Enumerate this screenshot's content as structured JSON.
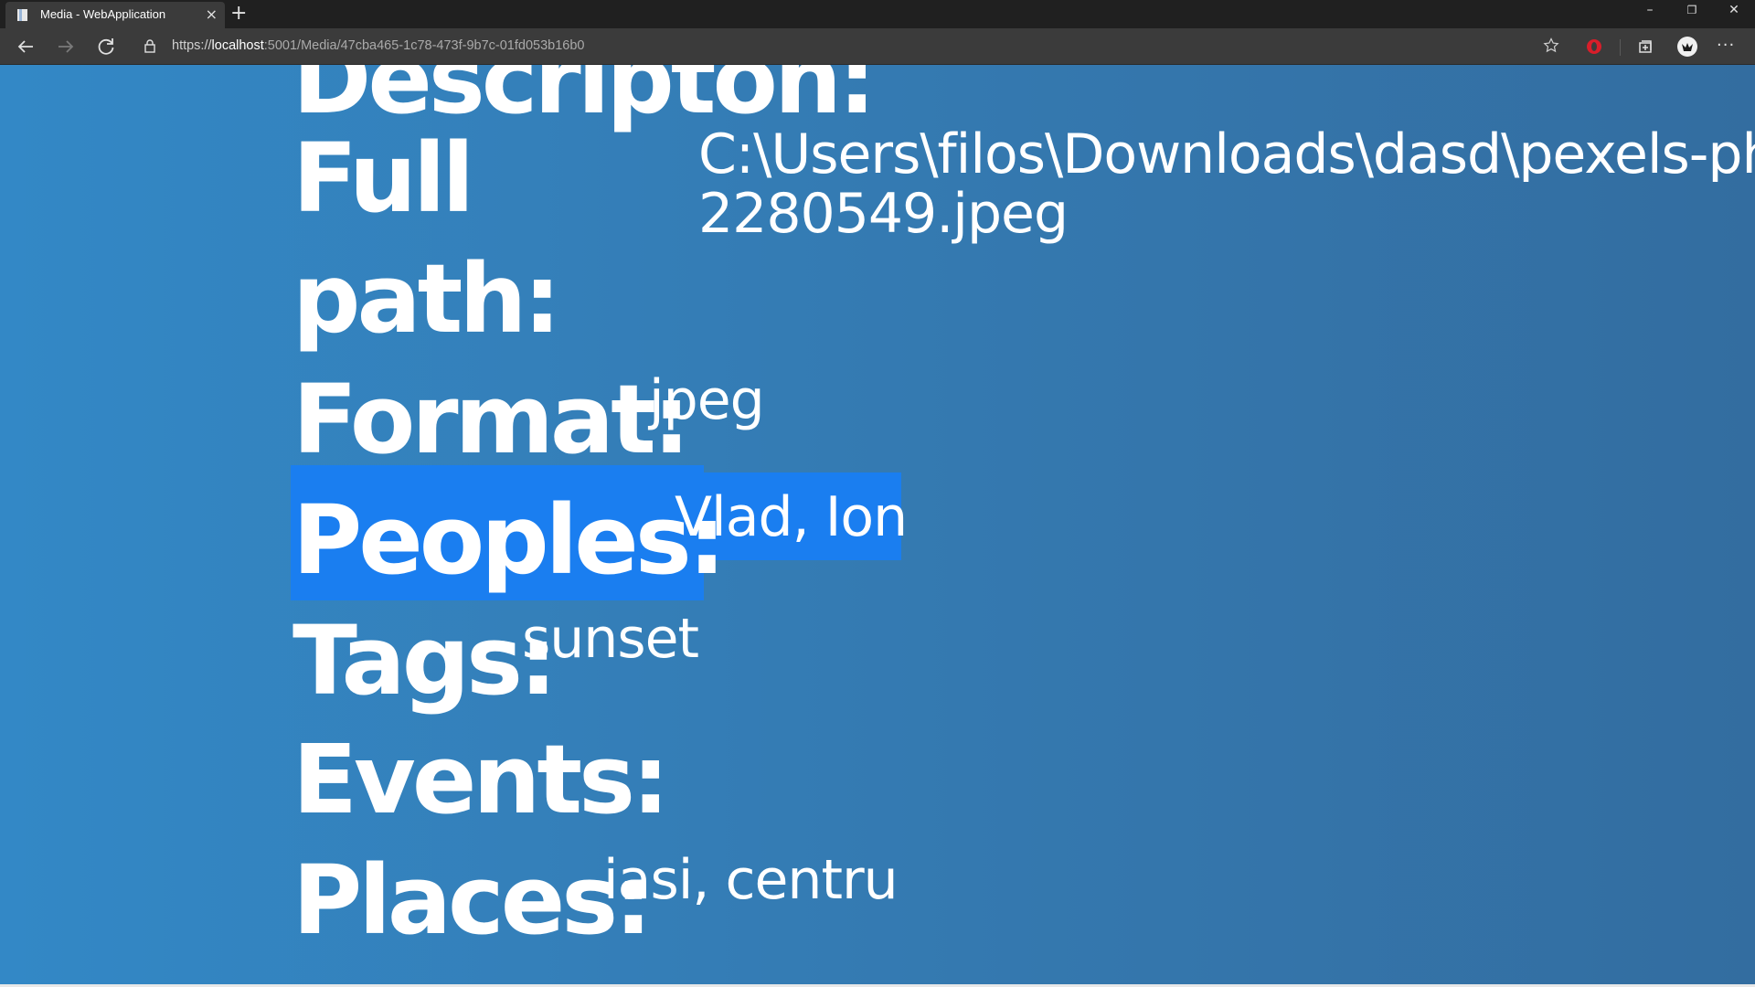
{
  "browser": {
    "tab_title": "Media - WebApplication",
    "tab_close": "×",
    "new_tab": "+",
    "url_scheme": "https://",
    "url_host": "localhost",
    "url_rest": ":5001/Media/47cba465-1c78-473f-9b7c-01fd053b16b0",
    "window_minimize": "–",
    "window_restore": "❐",
    "window_close": "✕",
    "more_menu": "···"
  },
  "media": {
    "description_label": "Descripton:",
    "description_value": "",
    "full_path_label_line1": "Full",
    "full_path_label_line2": "path:",
    "full_path_line1": "C:\\Users\\filos\\Downloads\\dasd\\pexels-ph",
    "full_path_line2": "2280549.jpeg",
    "format_label": "Format:",
    "format_value": "jpeg",
    "peoples_label": "Peoples:",
    "peoples_value": "Vlad, Ion",
    "tags_label": "Tags:",
    "tags_value": "sunset",
    "events_label": "Events:",
    "events_value": "",
    "places_label": "Places:",
    "places_value": "iasi, centru"
  },
  "colors": {
    "selection": "#1a7ef0",
    "page_gradient_start": "#3388c6",
    "page_gradient_end": "#336da0"
  }
}
